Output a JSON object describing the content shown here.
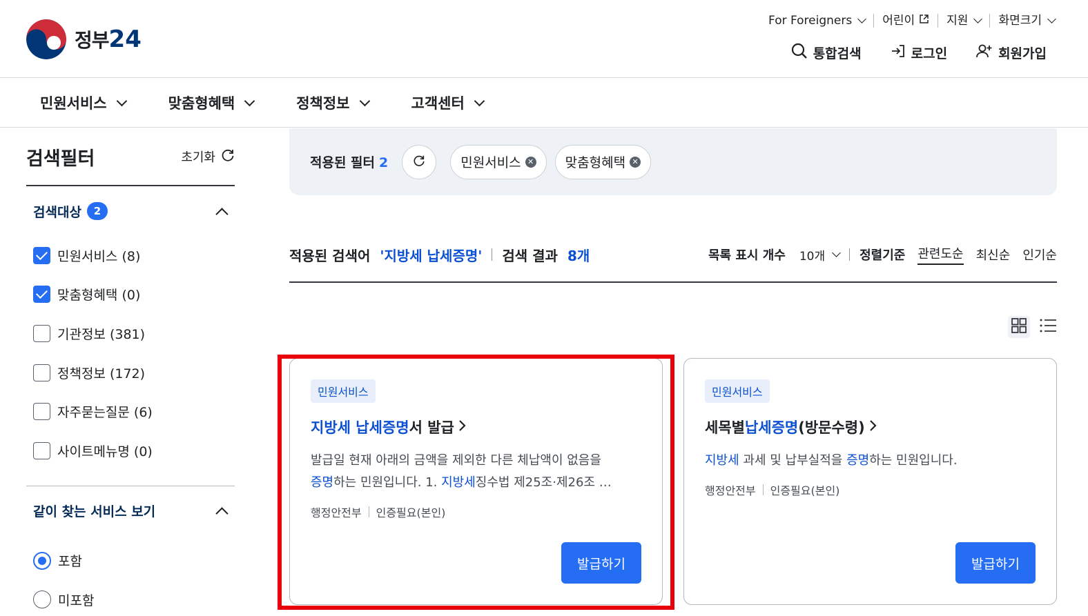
{
  "header": {
    "logo_text": "정부",
    "logo_num": "24",
    "util_top": [
      {
        "label": "For Foreigners",
        "icon": "chevron-down-icon"
      },
      {
        "label": "어린이",
        "icon": "external-link-icon"
      },
      {
        "label": "지원",
        "icon": "chevron-down-icon"
      },
      {
        "label": "화면크기",
        "icon": "chevron-down-icon"
      }
    ],
    "util_main": [
      {
        "label": "통합검색",
        "icon": "search-icon"
      },
      {
        "label": "로그인",
        "icon": "login-icon"
      },
      {
        "label": "회원가입",
        "icon": "user-add-icon"
      }
    ]
  },
  "gnb": [
    "민원서비스",
    "맞춤형혜택",
    "정책정보",
    "고객센터"
  ],
  "sidebar": {
    "title": "검색필터",
    "reset_label": "초기화",
    "target_section": {
      "title": "검색대상",
      "badge": "2",
      "items": [
        {
          "label": "민원서비스 (8)",
          "checked": true
        },
        {
          "label": "맞춤형혜택 (0)",
          "checked": true
        },
        {
          "label": "기관정보 (381)",
          "checked": false
        },
        {
          "label": "정책정보 (172)",
          "checked": false
        },
        {
          "label": "자주묻는질문 (6)",
          "checked": false
        },
        {
          "label": "사이트메뉴명 (0)",
          "checked": false
        }
      ]
    },
    "related_section": {
      "title": "같이 찾는 서비스 보기",
      "options": [
        {
          "label": "포함",
          "selected": true
        },
        {
          "label": "미포함",
          "selected": false
        }
      ]
    }
  },
  "filter_bar": {
    "label": "적용된 필터",
    "count": "2",
    "chips": [
      "민원서비스",
      "맞춤형혜택"
    ]
  },
  "results_head": {
    "keyword_label": "적용된 검색어",
    "keyword": "'지방세 납세증명'",
    "result_label": "검색 결과",
    "result_count": "8개",
    "per_page_label": "목록 표시 개수",
    "per_page_value": "10개",
    "sort_label": "정렬기준",
    "sort_options": [
      "관련도순",
      "최신순",
      "인기순"
    ],
    "active_sort": "관련도순"
  },
  "cards": [
    {
      "tag": "민원서비스",
      "title_hl": "지방세 납세증명",
      "title_rest": "서 발급",
      "desc_line1": "발급일 현재 아래의 금액을 제외한 다른 체납액이 없음을",
      "desc_l2_hl1": "증명",
      "desc_l2_t1": "하는 민원입니다. 1. ",
      "desc_l2_hl2": "지방세",
      "desc_l2_t2": "징수법 제25조·제26조 …",
      "org": "행정안전부",
      "auth": "인증필요(본인)",
      "button": "발급하기"
    },
    {
      "tag": "민원서비스",
      "title_pre": "세목별",
      "title_hl": "납세증명",
      "title_rest": "(방문수령)",
      "desc_hl1": "지방세",
      "desc_t1": " 과세 및 납부실적을 ",
      "desc_hl2": "증명",
      "desc_t2": "하는 민원입니다.",
      "org": "행정안전부",
      "auth": "인증필요(본인)",
      "button": "발급하기"
    }
  ],
  "colors": {
    "primary": "#256ef4",
    "highlight_text": "#0b50d0",
    "tag_bg": "#e8effa",
    "annotation_red": "#e8000b"
  }
}
